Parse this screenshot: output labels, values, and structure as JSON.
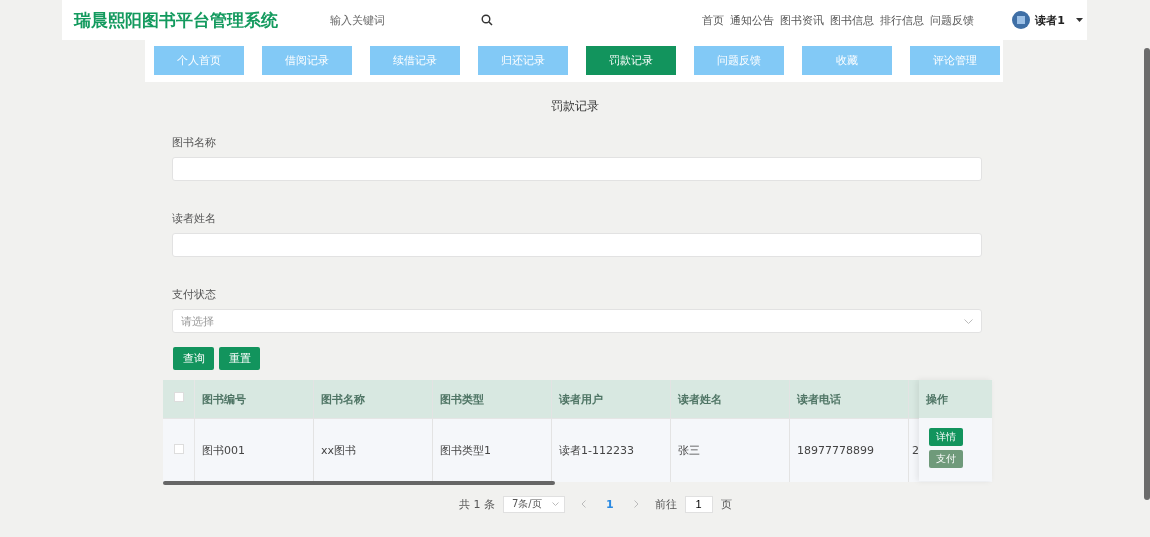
{
  "header": {
    "site_title": "瑞晨熙阳图书平台管理系统",
    "search": {
      "placeholder": "输入关键词"
    },
    "nav": [
      "首页",
      "通知公告",
      "图书资讯",
      "图书信息",
      "排行信息",
      "问题反馈"
    ],
    "user": {
      "name": "读者1"
    }
  },
  "tabs": [
    {
      "label": "个人首页",
      "selected": false
    },
    {
      "label": "借阅记录",
      "selected": false
    },
    {
      "label": "续借记录",
      "selected": false
    },
    {
      "label": "归还记录",
      "selected": false
    },
    {
      "label": "罚款记录",
      "selected": true
    },
    {
      "label": "问题反馈",
      "selected": false
    },
    {
      "label": "收藏",
      "selected": false
    },
    {
      "label": "评论管理",
      "selected": false
    }
  ],
  "page_title": "罚款记录",
  "filters": [
    {
      "kind": "text",
      "label": "图书名称"
    },
    {
      "kind": "text",
      "label": "读者姓名"
    },
    {
      "kind": "select",
      "label": "支付状态",
      "placeholder": "请选择"
    }
  ],
  "filter_buttons": [
    "查询",
    "重置"
  ],
  "table": {
    "select_all": {
      "checked": false
    },
    "columns": [
      "图书编号",
      "图书名称",
      "图书类型",
      "读者用户",
      "读者姓名",
      "读者电话"
    ],
    "action_column": "操作",
    "rows": [
      {
        "selected": false,
        "cells": [
          "图书001",
          "xx图书",
          "图书类型1",
          "读者1-112233",
          "张三",
          "18977778899"
        ],
        "column_8": "2",
        "actions": [
          {
            "kind": "primary",
            "label": "详情"
          },
          {
            "kind": "pay",
            "label": "支付"
          }
        ]
      }
    ]
  },
  "pagination": {
    "total": "共 1 条",
    "page_size": "7条/页",
    "pages": [
      {
        "label": "1",
        "selected": true
      }
    ],
    "goto_label": "前往",
    "goto_value": "1",
    "goto_suffix": "页"
  }
}
